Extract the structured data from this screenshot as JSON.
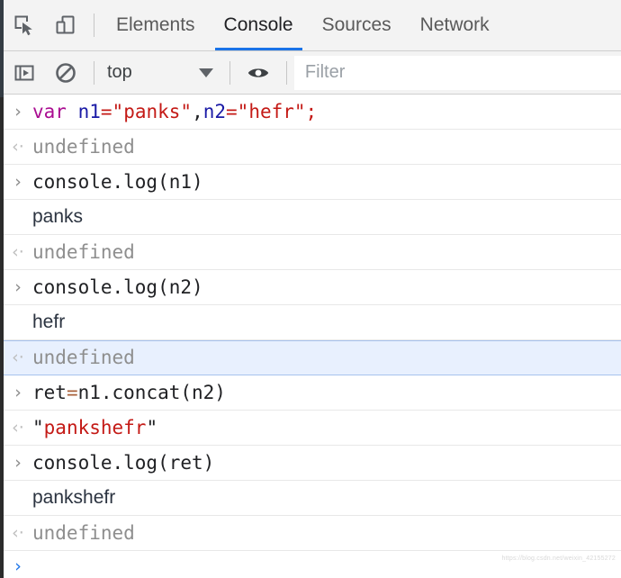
{
  "tabbar": {
    "inspect_icon": "inspect-cursor-icon",
    "device_icon": "device-toggle-icon",
    "tabs": [
      {
        "label": "Elements",
        "active": false
      },
      {
        "label": "Console",
        "active": true
      },
      {
        "label": "Sources",
        "active": false
      },
      {
        "label": "Network",
        "active": false
      }
    ]
  },
  "filterbar": {
    "sidebar_toggle_icon": "console-sidebar-toggle-icon",
    "clear_icon": "clear-console-icon",
    "context": "top",
    "caret_icon": "chevron-down-icon",
    "eye_icon": "live-expression-eye-icon",
    "filter_placeholder": "Filter",
    "filter_value": ""
  },
  "console": {
    "input_marker": "›",
    "output_marker": "‹·",
    "messages": [
      {
        "kind": "input",
        "marker": "›",
        "tokens": [
          {
            "t": "var",
            "c": "kw"
          },
          {
            "t": " ",
            "c": "plain"
          },
          {
            "t": "n1",
            "c": "var"
          },
          {
            "t": "=",
            "c": "str"
          },
          {
            "t": "\"panks\"",
            "c": "str"
          },
          {
            "t": ",",
            "c": "punc"
          },
          {
            "t": "n2",
            "c": "var"
          },
          {
            "t": "=",
            "c": "str"
          },
          {
            "t": "\"hefr\"",
            "c": "str"
          },
          {
            "t": ";",
            "c": "str"
          }
        ],
        "plain": "var n1=\"panks\",n2=\"hefr\";",
        "selected": false
      },
      {
        "kind": "output",
        "marker": "‹·",
        "tokens": [
          {
            "t": "undefined",
            "c": "undef"
          }
        ],
        "plain": "undefined",
        "selected": false
      },
      {
        "kind": "input",
        "marker": "›",
        "tokens": [
          {
            "t": "console.log(n1)",
            "c": "plain"
          }
        ],
        "plain": "console.log(n1)",
        "selected": false
      },
      {
        "kind": "logged",
        "marker": "",
        "tokens": [
          {
            "t": "panks",
            "c": "logged"
          }
        ],
        "plain": "panks",
        "selected": false
      },
      {
        "kind": "output",
        "marker": "‹·",
        "tokens": [
          {
            "t": "undefined",
            "c": "undef"
          }
        ],
        "plain": "undefined",
        "selected": false
      },
      {
        "kind": "input",
        "marker": "›",
        "tokens": [
          {
            "t": "console.log(n2)",
            "c": "plain"
          }
        ],
        "plain": "console.log(n2)",
        "selected": false
      },
      {
        "kind": "logged",
        "marker": "",
        "tokens": [
          {
            "t": "hefr",
            "c": "logged"
          }
        ],
        "plain": "hefr",
        "selected": false
      },
      {
        "kind": "output",
        "marker": "‹·",
        "tokens": [
          {
            "t": "undefined",
            "c": "undef"
          }
        ],
        "plain": "undefined",
        "selected": true
      },
      {
        "kind": "input",
        "marker": "›",
        "tokens": [
          {
            "t": "ret",
            "c": "plain"
          },
          {
            "t": "=",
            "c": "op"
          },
          {
            "t": "n1.concat(n2)",
            "c": "plain"
          }
        ],
        "plain": "ret=n1.concat(n2)",
        "selected": false
      },
      {
        "kind": "output",
        "marker": "‹·",
        "tokens": [
          {
            "t": "\"",
            "c": "quote"
          },
          {
            "t": "pankshefr",
            "c": "str"
          },
          {
            "t": "\"",
            "c": "quote"
          }
        ],
        "plain": "\"pankshefr\"",
        "selected": false
      },
      {
        "kind": "input",
        "marker": "›",
        "tokens": [
          {
            "t": "console.log(ret)",
            "c": "plain"
          }
        ],
        "plain": "console.log(ret)",
        "selected": false
      },
      {
        "kind": "logged",
        "marker": "",
        "tokens": [
          {
            "t": "pankshefr",
            "c": "logged"
          }
        ],
        "plain": "pankshefr",
        "selected": false
      },
      {
        "kind": "output",
        "marker": "‹·",
        "tokens": [
          {
            "t": "undefined",
            "c": "undef"
          }
        ],
        "plain": "undefined",
        "selected": false
      }
    ],
    "prompt_marker": "›"
  },
  "watermark": "https://blog.csdn.net/weixin_42155272",
  "colors": {
    "accent": "#1a73e8",
    "toolbar_bg": "#f3f3f3",
    "selected_row_bg": "#e8f0fe",
    "keyword": "#aa0d91",
    "variable": "#1a1aa6",
    "string": "#c41a16",
    "operator": "#a8603a",
    "undefined_text": "#8e8e8e"
  }
}
